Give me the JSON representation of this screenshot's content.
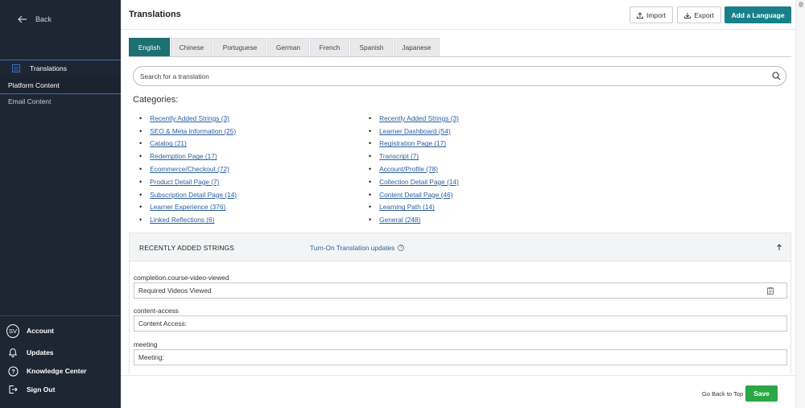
{
  "sidebar": {
    "back_label": "Back",
    "translations_label": "Translations",
    "platform_content_label": "Platform Content",
    "email_content_label": "Email Content",
    "avatar_initials": "SV",
    "bottom_items": [
      {
        "label": "Account",
        "icon": "avatar"
      },
      {
        "label": "Updates",
        "icon": "bell-icon"
      },
      {
        "label": "Knowledge Center",
        "icon": "help-icon"
      },
      {
        "label": "Sign Out",
        "icon": "sign-out-icon"
      }
    ]
  },
  "header": {
    "title": "Translations",
    "import_label": "Import",
    "export_label": "Export",
    "add_language_label": "Add a Language"
  },
  "tabs": [
    "English",
    "Chinese",
    "Portuguese",
    "German",
    "French",
    "Spanish",
    "Japanese"
  ],
  "active_tab": "English",
  "search": {
    "placeholder": "Search for a translation"
  },
  "categories_title": "Categories:",
  "categories_left": [
    "Recently Added Strings (3)",
    "SEO & Meta Information (25)",
    "Catalog (21)",
    "Redemption Page (17)",
    "Ecommerce/Checkout (72)",
    "Product Detail Page (7)",
    "Subscription Detail Page (14)",
    "Learner Experience (376)",
    "Linked Reflections (6)"
  ],
  "categories_right": [
    "Recently Added Strings (3)",
    "Learner Dashboard (54)",
    "Registration Page (17)",
    "Transcript (7)",
    "Account/Profile (78)",
    "Collection Detail Page (14)",
    "Content Detail Page (46)",
    "Learning Path (14)",
    "General (248)"
  ],
  "panel": {
    "title": "RECENTLY ADDED STRINGS",
    "toggle_label": "Turn-On Translation updates",
    "help_glyph": "?"
  },
  "strings": [
    {
      "key": "completion.course-video-viewed",
      "value": "Required Videos Viewed"
    },
    {
      "key": "content-access",
      "value": "Content Access:"
    },
    {
      "key": "meeting",
      "value": "Meeting:"
    }
  ],
  "footer": {
    "back_to_top_label": "Go Back to Top |",
    "save_label": "Save"
  },
  "colors": {
    "sidebar_bg": "#1f2633",
    "accent_blue": "#3a6fc4",
    "primary_teal": "#18808a",
    "active_tab": "#1d6f71",
    "link": "#2a5f9e",
    "save_green": "#2aa845"
  }
}
